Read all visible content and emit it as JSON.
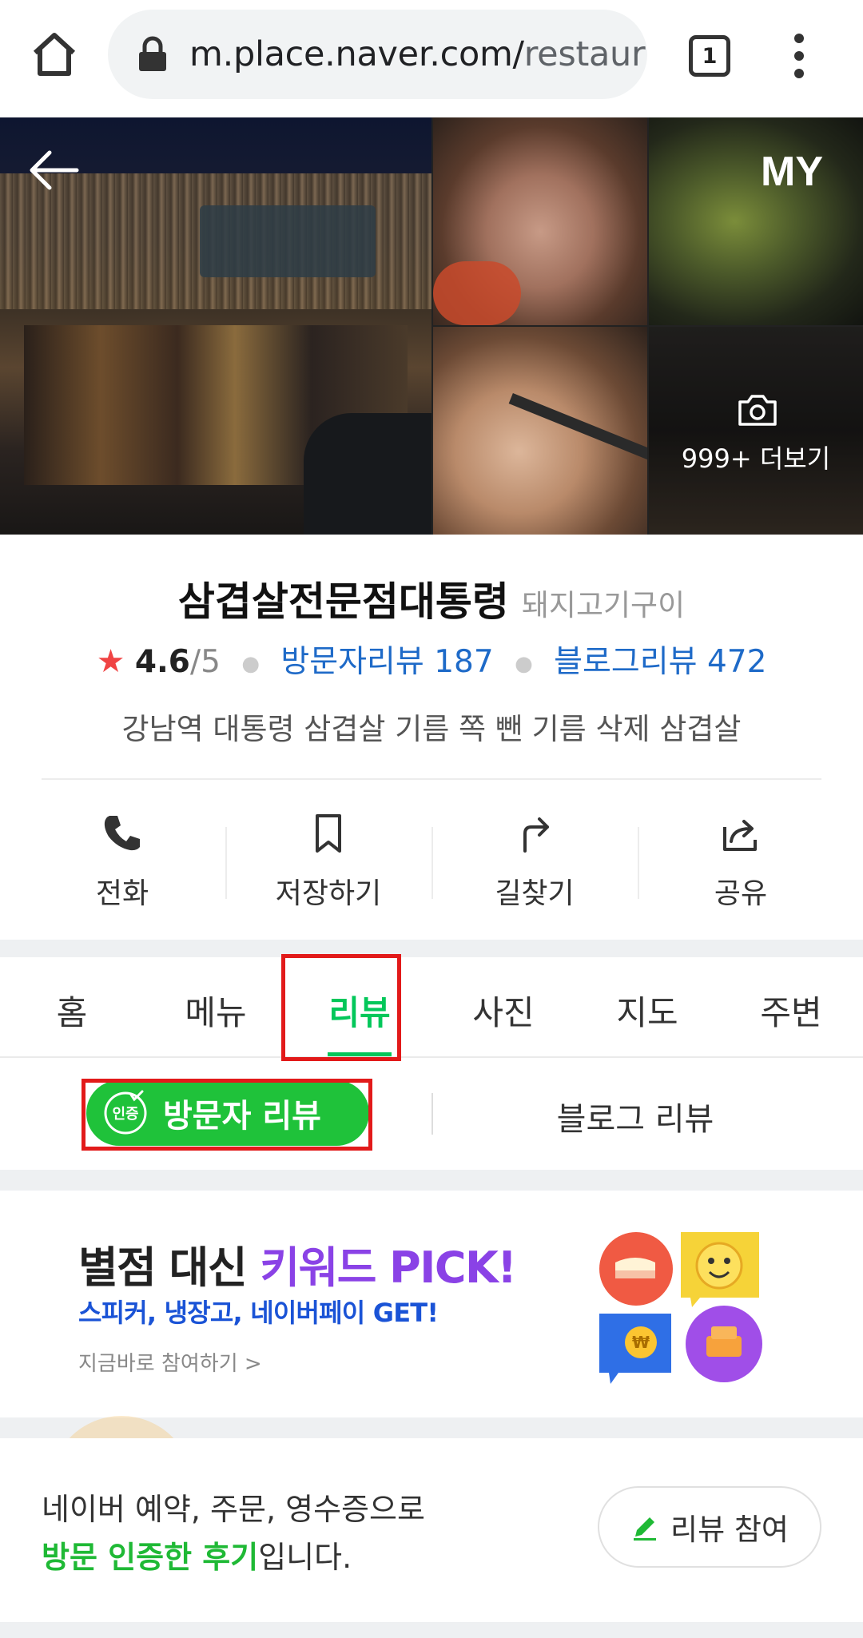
{
  "browser": {
    "url_host": "m.place.naver.com/",
    "url_path": "restaura",
    "tab_count": "1"
  },
  "photos": {
    "my_label": "MY",
    "more_label": "999+ 더보기"
  },
  "place": {
    "name": "삼겹살전문점대통령",
    "category": "돼지고기구이",
    "rating": "4.6",
    "rating_max": "/5",
    "visitor_reviews": "방문자리뷰 187",
    "blog_reviews": "블로그리뷰 472",
    "description": "강남역 대통령 삼겹살 기름 쪽 뺀 기름 삭제 삼겹살"
  },
  "actions": [
    {
      "label": "전화",
      "icon": "phone-icon"
    },
    {
      "label": "저장하기",
      "icon": "bookmark-icon"
    },
    {
      "label": "길찾기",
      "icon": "directions-icon"
    },
    {
      "label": "공유",
      "icon": "share-icon"
    }
  ],
  "tabs": [
    {
      "label": "홈"
    },
    {
      "label": "메뉴"
    },
    {
      "label": "리뷰",
      "active": true
    },
    {
      "label": "사진"
    },
    {
      "label": "지도"
    },
    {
      "label": "주변"
    }
  ],
  "subtabs": {
    "badge": "인증",
    "visitor": "방문자 리뷰",
    "blog": "블로그 리뷰"
  },
  "banner": {
    "title_pre": "별점 대신 ",
    "title_kw": "키워드 PICK!",
    "subtitle": "스피커, 냉장고, 네이버페이 GET!",
    "cta": "지금바로 참여하기 >"
  },
  "notice": {
    "line1": "네이버 예약, 주문, 영수증으로",
    "line2_green": "방문 인증한 후기",
    "line2_rest": "입니다.",
    "button": "리뷰 참여"
  },
  "colors": {
    "accent_green": "#03c75a",
    "link_blue": "#1e6ac8",
    "highlight_red": "#e21a1a",
    "keyword_purple": "#8a42e6"
  }
}
